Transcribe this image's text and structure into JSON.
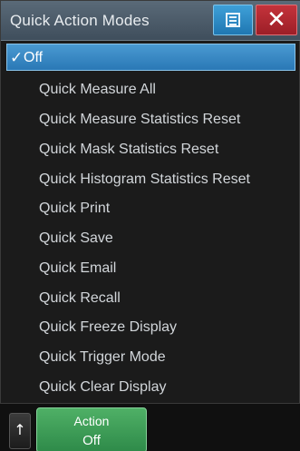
{
  "dialog": {
    "title": "Quick Action Modes",
    "menu_icon": "list-icon",
    "close_label": "✕"
  },
  "items": [
    {
      "label": "Off",
      "selected": true
    },
    {
      "label": "Quick Measure All"
    },
    {
      "label": "Quick Measure Statistics Reset"
    },
    {
      "label": "Quick Mask Statistics Reset"
    },
    {
      "label": "Quick Histogram Statistics Reset"
    },
    {
      "label": "Quick Print"
    },
    {
      "label": "Quick Save"
    },
    {
      "label": "Quick Email"
    },
    {
      "label": "Quick Recall"
    },
    {
      "label": "Quick Freeze Display"
    },
    {
      "label": "Quick Trigger Mode"
    },
    {
      "label": "Quick Clear Display"
    }
  ],
  "bottombar": {
    "up_icon": "arrow-up-icon",
    "up_label": "↑",
    "action_label": "Action",
    "action_value": "Off"
  },
  "colors": {
    "selected": "#3a89c5",
    "close": "#b0282f",
    "menu": "#2b8ac4",
    "action": "#3f9f58"
  }
}
